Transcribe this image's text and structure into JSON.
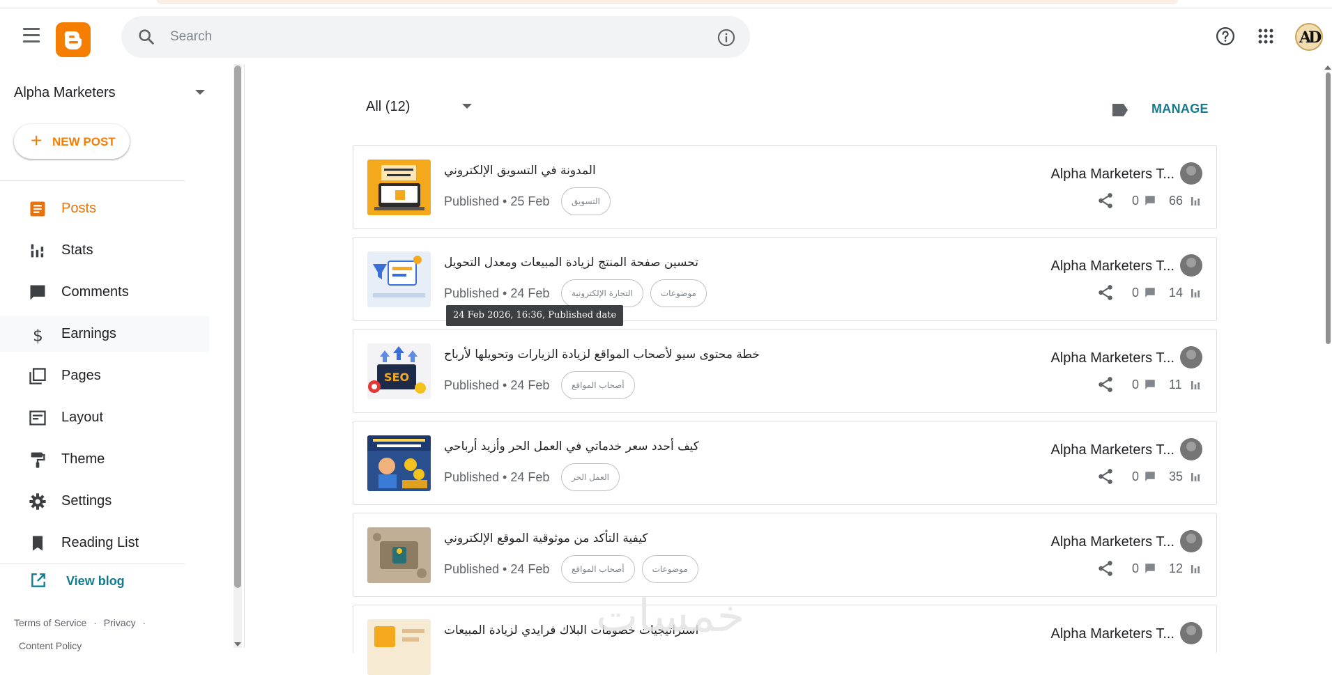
{
  "header": {
    "search_placeholder": "Search",
    "avatar_initials": "AD"
  },
  "sidebar": {
    "blog_name": "Alpha Marketers",
    "new_post_label": "NEW POST",
    "items": [
      {
        "label": "Posts",
        "icon": "posts-icon",
        "active": true
      },
      {
        "label": "Stats",
        "icon": "stats-icon"
      },
      {
        "label": "Comments",
        "icon": "comments-icon"
      },
      {
        "label": "Earnings",
        "icon": "dollar-icon"
      },
      {
        "label": "Pages",
        "icon": "pages-icon"
      },
      {
        "label": "Layout",
        "icon": "layout-icon"
      },
      {
        "label": "Theme",
        "icon": "paint-roller-icon"
      },
      {
        "label": "Settings",
        "icon": "gear-icon"
      },
      {
        "label": "Reading List",
        "icon": "bookmark-icon"
      }
    ],
    "view_blog_label": "View blog",
    "footer_links": [
      "Terms of Service",
      "Privacy",
      "Content Policy"
    ],
    "footer_separator": "·"
  },
  "main": {
    "filter_label": "All (12)",
    "manage_label": "MANAGE",
    "tooltip": "24 Feb 2026, 16:36, Published date",
    "watermark": "خمسات",
    "posts": [
      {
        "title": "المدونة في التسويق الإلكتروني",
        "status": "Published • 25 Feb",
        "tags": [
          "التسويق"
        ],
        "author": "Alpha Marketers T...",
        "comments": "0",
        "views": "66"
      },
      {
        "title": "تحسين صفحة المنتج لزيادة المبيعات ومعدل التحويل",
        "status": "Published • 24 Feb",
        "tags": [
          "التجارة الإلكترونية",
          "موضوعات"
        ],
        "author": "Alpha Marketers T...",
        "comments": "0",
        "views": "14"
      },
      {
        "title": "خطة محتوى سيو لأصحاب المواقع لزيادة الزيارات وتحويلها لأرباح",
        "status": "Published • 24 Feb",
        "tags": [
          "أصحاب المواقع"
        ],
        "author": "Alpha Marketers T...",
        "comments": "0",
        "views": "11"
      },
      {
        "title": "كيف أحدد سعر خدماتي في العمل الحر وأزيد أرباحي",
        "status": "Published • 24 Feb",
        "tags": [
          "العمل الحر"
        ],
        "author": "Alpha Marketers T...",
        "comments": "0",
        "views": "35"
      },
      {
        "title": "كيفية التأكد من موثوقية الموقع الإلكتروني",
        "status": "Published • 24 Feb",
        "tags": [
          "أصحاب المواقع",
          "موضوعات"
        ],
        "author": "Alpha Marketers T...",
        "comments": "0",
        "views": "12"
      },
      {
        "title": "استراتيجيات خصومات البلاك فرايدي لزيادة المبيعات",
        "status": "",
        "tags": [],
        "author": "Alpha Marketers T...",
        "comments": "",
        "views": ""
      }
    ]
  },
  "colors": {
    "brand_orange": "#f57d00",
    "active_orange": "#e8710a",
    "teal_link": "#137b8c"
  }
}
